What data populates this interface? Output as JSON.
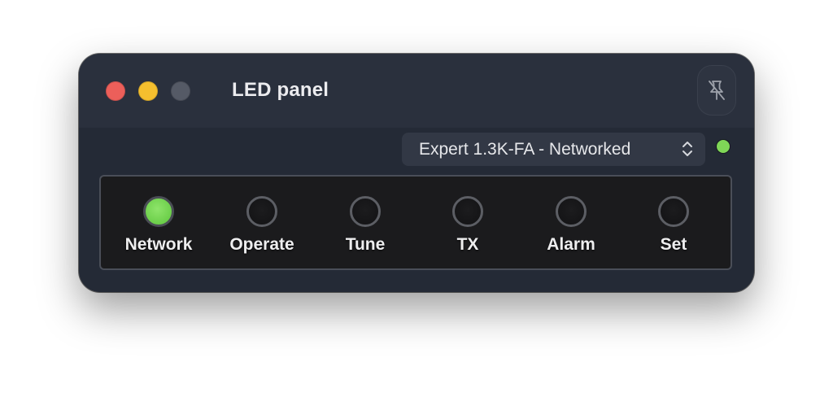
{
  "window": {
    "title": "LED panel",
    "controls": {
      "close_color": "#ec5f5a",
      "minimize_color": "#f5bf2e",
      "zoom_color": "#555a66"
    },
    "pin_button_icon": "pin-slash-icon"
  },
  "device_select": {
    "value": "Expert 1.3K-FA - Networked",
    "icon": "up-down-chevron-icon"
  },
  "connection_status": {
    "state": "on",
    "color": "#7fd657"
  },
  "leds": [
    {
      "label": "Network",
      "state": "on",
      "color": "#6ccf4a"
    },
    {
      "label": "Operate",
      "state": "off"
    },
    {
      "label": "Tune",
      "state": "off"
    },
    {
      "label": "TX",
      "state": "off"
    },
    {
      "label": "Alarm",
      "state": "off"
    },
    {
      "label": "Set",
      "state": "off"
    }
  ]
}
